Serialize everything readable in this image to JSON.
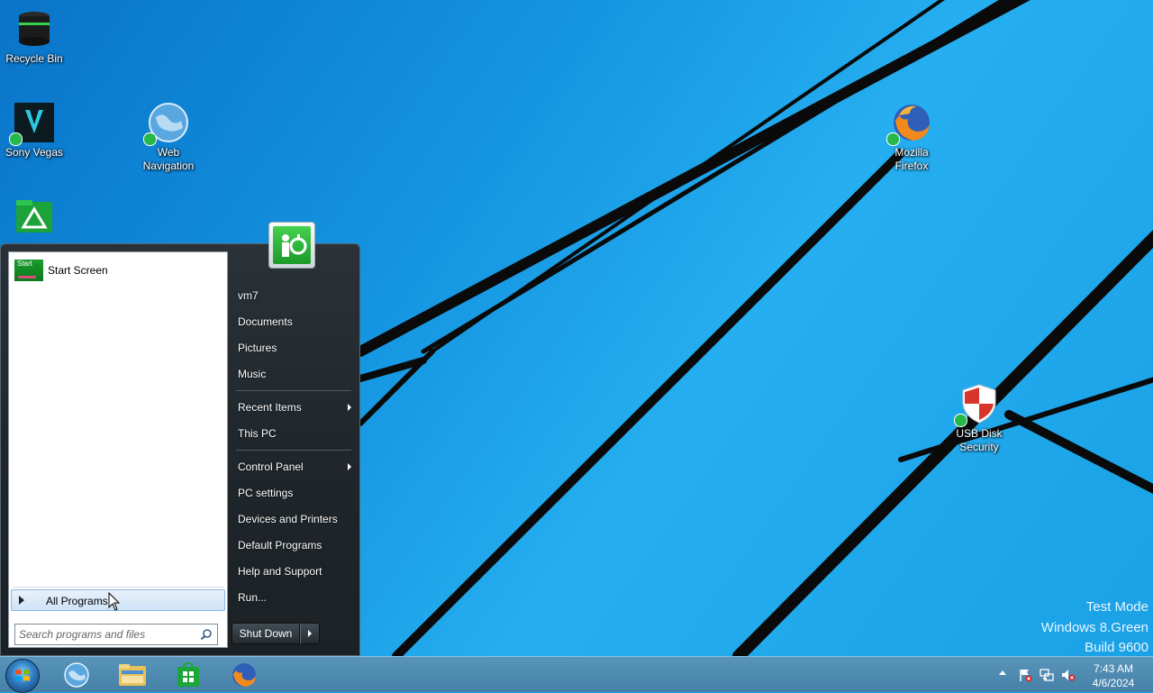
{
  "desktop": {
    "icons": {
      "recycle_bin": "Recycle Bin",
      "sony_vegas": "Sony Vegas",
      "web_navigation": "Web Navigation",
      "mozilla_firefox": "Mozilla Firefox",
      "usb_disk_security": "USB Disk Security"
    },
    "watermark": {
      "line1": "Test Mode",
      "line2": "Windows 8.Green",
      "line3": "Build 9600"
    }
  },
  "start_menu": {
    "pinned": {
      "tile_text": "Start",
      "label": "Start Screen"
    },
    "all_programs": "All Programs",
    "search": {
      "placeholder": "Search programs and files",
      "value": ""
    },
    "right_items": {
      "user": "vm7",
      "documents": "Documents",
      "pictures": "Pictures",
      "music": "Music",
      "recent_items": "Recent Items",
      "this_pc": "This PC",
      "control_panel": "Control Panel",
      "pc_settings": "PC settings",
      "devices_printers": "Devices and Printers",
      "default_programs": "Default Programs",
      "help_support": "Help and Support",
      "run": "Run..."
    },
    "shutdown": "Shut Down"
  },
  "taskbar": {
    "pinned_icons": [
      "globe-icon",
      "file-explorer-icon",
      "store-icon",
      "firefox-icon"
    ],
    "tray_icons": [
      "show-hidden-icons",
      "action-center-flag-icon",
      "network-icon",
      "volume-muted-icon"
    ],
    "clock": {
      "time": "7:43 AM",
      "date": "4/6/2024"
    }
  },
  "colors": {
    "desktop_bg": "#1aa3e8",
    "menu_dark": "#20272c",
    "accent_green": "#1c9a2a"
  }
}
